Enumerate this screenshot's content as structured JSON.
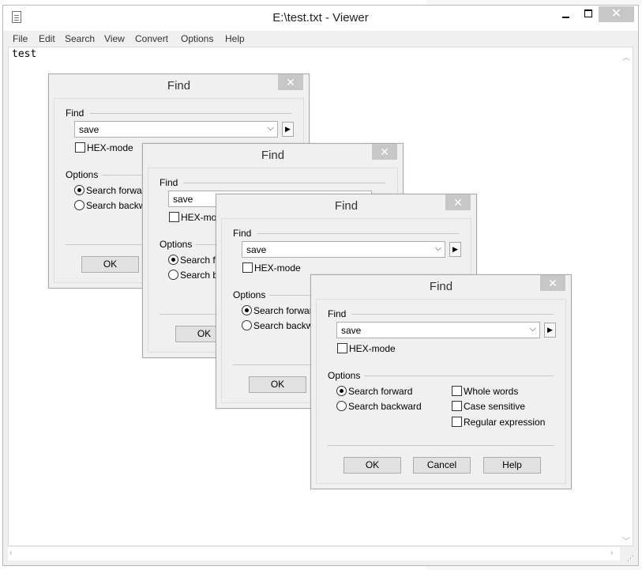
{
  "window": {
    "title": "E:\\test.txt - Viewer",
    "close_glyph": "✕",
    "menu": [
      "File",
      "Edit",
      "Search",
      "View",
      "Convert",
      "Options",
      "Help"
    ]
  },
  "editor": {
    "content": "test"
  },
  "dialog": {
    "title": "Find",
    "close_glyph": "✕",
    "find_group": "Find",
    "find_value": "save",
    "hex_mode": "HEX-mode",
    "options_group": "Options",
    "search_forward": "Search forward",
    "search_backward": "Search backward",
    "search_forward_clipped": "Search forwarc",
    "search_backward_clipped": "Search backwa",
    "search_forward_clipped2": "Search fo",
    "search_backward_clipped2": "Search ba",
    "search_forward_clipped3": "Search forwarc",
    "search_backward_clipped3": "Search backwa",
    "whole_words": "Whole words",
    "case_sensitive": "Case sensitive",
    "regular_expression": "Regular expression",
    "ok": "OK",
    "cancel": "Cancel",
    "help": "Help",
    "selected_direction": "forward"
  },
  "icons": {
    "combo_arrow": "chevron-down-icon",
    "history_arrow": "triangle-right-icon",
    "app": "document-icon"
  },
  "colors": {
    "close_button": "#c7c7c7",
    "window_bg": "#f0f0f0"
  }
}
